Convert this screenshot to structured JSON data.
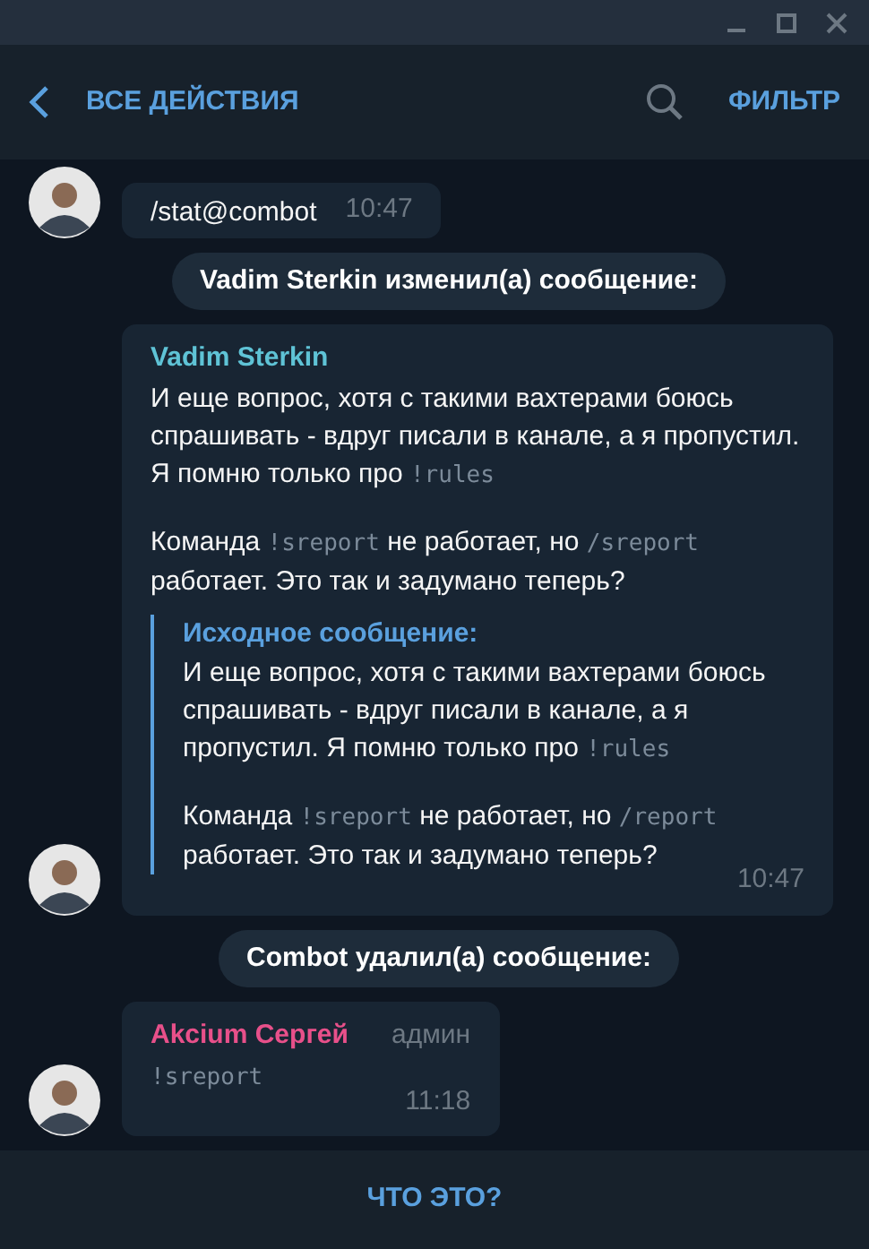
{
  "header": {
    "title": "ВСЕ ДЕЙСТВИЯ",
    "filter": "ФИЛЬТР"
  },
  "events": [
    {
      "kind": "message",
      "compact": true,
      "paragraphs": [
        [
          {
            "text": "/stat@combot",
            "code": false
          }
        ]
      ],
      "time": "10:47"
    },
    {
      "kind": "service",
      "text": "Vadim Sterkin изменил(а) сообщение:"
    },
    {
      "kind": "message",
      "compact": false,
      "author": "Vadim Sterkin",
      "color": "#5fc3d6",
      "paragraphs": [
        [
          {
            "text": "И еще вопрос, хотя с такими вахтерами боюсь спрашивать - вдруг писали в канале, а я пропустил. Я помню только про ",
            "code": false
          },
          {
            "text": "!rules",
            "code": true
          }
        ],
        [
          {
            "text": "Команда ",
            "code": false
          },
          {
            "text": "!sreport",
            "code": true
          },
          {
            "text": " не работает, но ",
            "code": false
          },
          {
            "text": "/sreport",
            "code": true
          },
          {
            "text": " работает. Это так и задумано теперь?",
            "code": false
          }
        ]
      ],
      "quote": {
        "title": "Исходное сообщение:",
        "paragraphs": [
          [
            {
              "text": "И еще вопрос, хотя с такими вахтерами боюсь спрашивать - вдруг писали в канале, а я пропустил. Я помню только про ",
              "code": false
            },
            {
              "text": "!rules",
              "code": true
            }
          ],
          [
            {
              "text": "Команда ",
              "code": false
            },
            {
              "text": "!sreport",
              "code": true
            },
            {
              "text": " не работает, но ",
              "code": false
            },
            {
              "text": "/report",
              "code": true
            },
            {
              "text": " работает. Это так и задумано теперь?",
              "code": false
            }
          ]
        ]
      },
      "time": "10:47"
    },
    {
      "kind": "service",
      "text": "Combot удалил(а) сообщение:"
    },
    {
      "kind": "message",
      "compact": false,
      "author": "Akcium Сергей",
      "color": "#e8508a",
      "badge": "админ",
      "paragraphs": [
        [
          {
            "text": "!sreport",
            "code": true
          }
        ]
      ],
      "time": "11:18"
    }
  ],
  "footer": {
    "button": "ЧТО ЭТО?"
  }
}
